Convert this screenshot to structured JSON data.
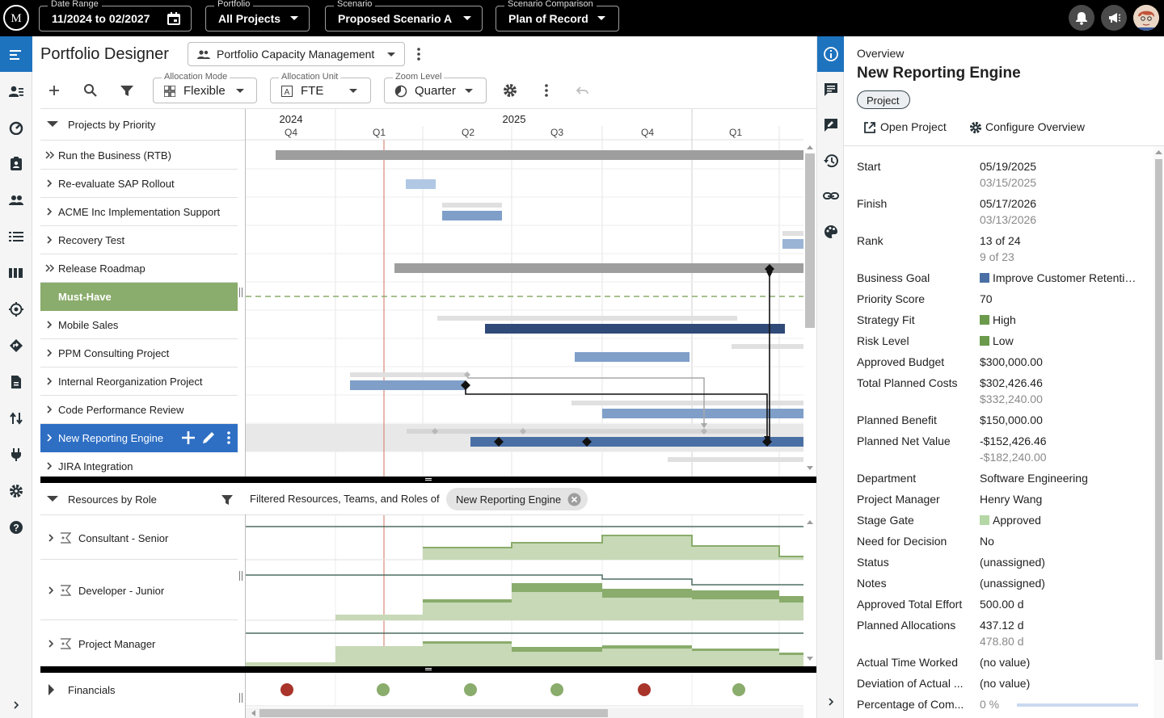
{
  "topbar": {
    "date_range": {
      "label": "Date Range",
      "value": "11/2024 to 02/2027"
    },
    "portfolio": {
      "label": "Portfolio",
      "value": "All Projects"
    },
    "scenario": {
      "label": "Scenario",
      "value": "Proposed Scenario A"
    },
    "scenario_comparison": {
      "label": "Scenario Comparison",
      "value": "Plan of Record"
    }
  },
  "header": {
    "title": "Portfolio Designer",
    "view": "Portfolio Capacity Management"
  },
  "toolbar": {
    "allocation_mode": {
      "label": "Allocation Mode",
      "value": "Flexible"
    },
    "allocation_unit": {
      "label": "Allocation Unit",
      "value": "FTE"
    },
    "zoom_level": {
      "label": "Zoom Level",
      "value": "Quarter"
    }
  },
  "timeline": {
    "years": [
      "2024",
      "2025"
    ],
    "quarters": [
      "Q4",
      "Q1",
      "Q2",
      "Q3",
      "Q4",
      "Q1"
    ]
  },
  "projects": {
    "group_label": "Projects by Priority",
    "rows": [
      {
        "label": "Run the Business (RTB)"
      },
      {
        "label": "Re-evaluate SAP Rollout"
      },
      {
        "label": "ACME Inc Implementation Support"
      },
      {
        "label": "Recovery Test"
      },
      {
        "label": "Release Roadmap"
      },
      {
        "label": "Must-Have"
      },
      {
        "label": "Mobile Sales"
      },
      {
        "label": "PPM Consulting Project"
      },
      {
        "label": "Internal Reorganization Project"
      },
      {
        "label": "Code Performance Review"
      },
      {
        "label": "New Reporting Engine"
      },
      {
        "label": "JIRA Integration"
      }
    ]
  },
  "resources": {
    "group_label": "Resources by Role",
    "filter_text": "Filtered Resources, Teams, and Roles of",
    "filter_chip": "New Reporting Engine",
    "rows": [
      {
        "label": "Consultant - Senior"
      },
      {
        "label": "Developer - Junior"
      },
      {
        "label": "Project Manager"
      }
    ]
  },
  "financials": {
    "label": "Financials"
  },
  "colors": {
    "accent": "#1e73be",
    "selected_row": "#2e6fc4",
    "must_have": "#8aac6c",
    "bar_dark": "#2f4a78",
    "bar_mid": "#7f9fc9",
    "bar_light": "#b0c8e4",
    "bar_gray": "#9e9e9e",
    "dot_red": "#a8342a",
    "dot_green": "#8aac6c"
  },
  "overview": {
    "section": "Overview",
    "title": "New Reporting Engine",
    "chip": "Project",
    "open_project": "Open Project",
    "configure": "Configure Overview",
    "fields": {
      "start": {
        "label": "Start",
        "value": "05/19/2025",
        "compare": "03/15/2025"
      },
      "finish": {
        "label": "Finish",
        "value": "05/17/2026",
        "compare": "03/13/2026"
      },
      "rank": {
        "label": "Rank",
        "value": "13 of 24",
        "compare": "9 of 23"
      },
      "business_goal": {
        "label": "Business Goal",
        "value": "Improve Customer Retenti…",
        "color": "#4a6fa5"
      },
      "priority_score": {
        "label": "Priority Score",
        "value": "70"
      },
      "strategy_fit": {
        "label": "Strategy Fit",
        "value": "High",
        "color": "#6b9a4d"
      },
      "risk_level": {
        "label": "Risk Level",
        "value": "Low",
        "color": "#6b9a4d"
      },
      "approved_budget": {
        "label": "Approved Budget",
        "value": "$300,000.00"
      },
      "total_planned_costs": {
        "label": "Total Planned Costs",
        "value": "$302,426.46",
        "compare": "$332,240.00"
      },
      "planned_benefit": {
        "label": "Planned Benefit",
        "value": "$150,000.00"
      },
      "planned_net_value": {
        "label": "Planned Net Value",
        "value": "-$152,426.46",
        "compare": "-$182,240.00"
      },
      "department": {
        "label": "Department",
        "value": "Software Engineering"
      },
      "project_manager": {
        "label": "Project Manager",
        "value": "Henry Wang"
      },
      "stage_gate": {
        "label": "Stage Gate",
        "value": "Approved",
        "color": "#b5d6a5"
      },
      "need_for_decision": {
        "label": "Need for Decision",
        "value": "No"
      },
      "status": {
        "label": "Status",
        "value": "(unassigned)"
      },
      "notes": {
        "label": "Notes",
        "value": "(unassigned)"
      },
      "approved_total_effort": {
        "label": "Approved Total Effort",
        "value": "500.00 d"
      },
      "planned_allocations": {
        "label": "Planned Allocations",
        "value": "437.12 d",
        "compare": "478.80 d"
      },
      "actual_time_worked": {
        "label": "Actual Time Worked",
        "value": "(no value)"
      },
      "deviation": {
        "label": "Deviation of Actual ...",
        "value": "(no value)"
      },
      "percentage_complete": {
        "label": "Percentage of Com...",
        "value": "0 %"
      }
    }
  }
}
